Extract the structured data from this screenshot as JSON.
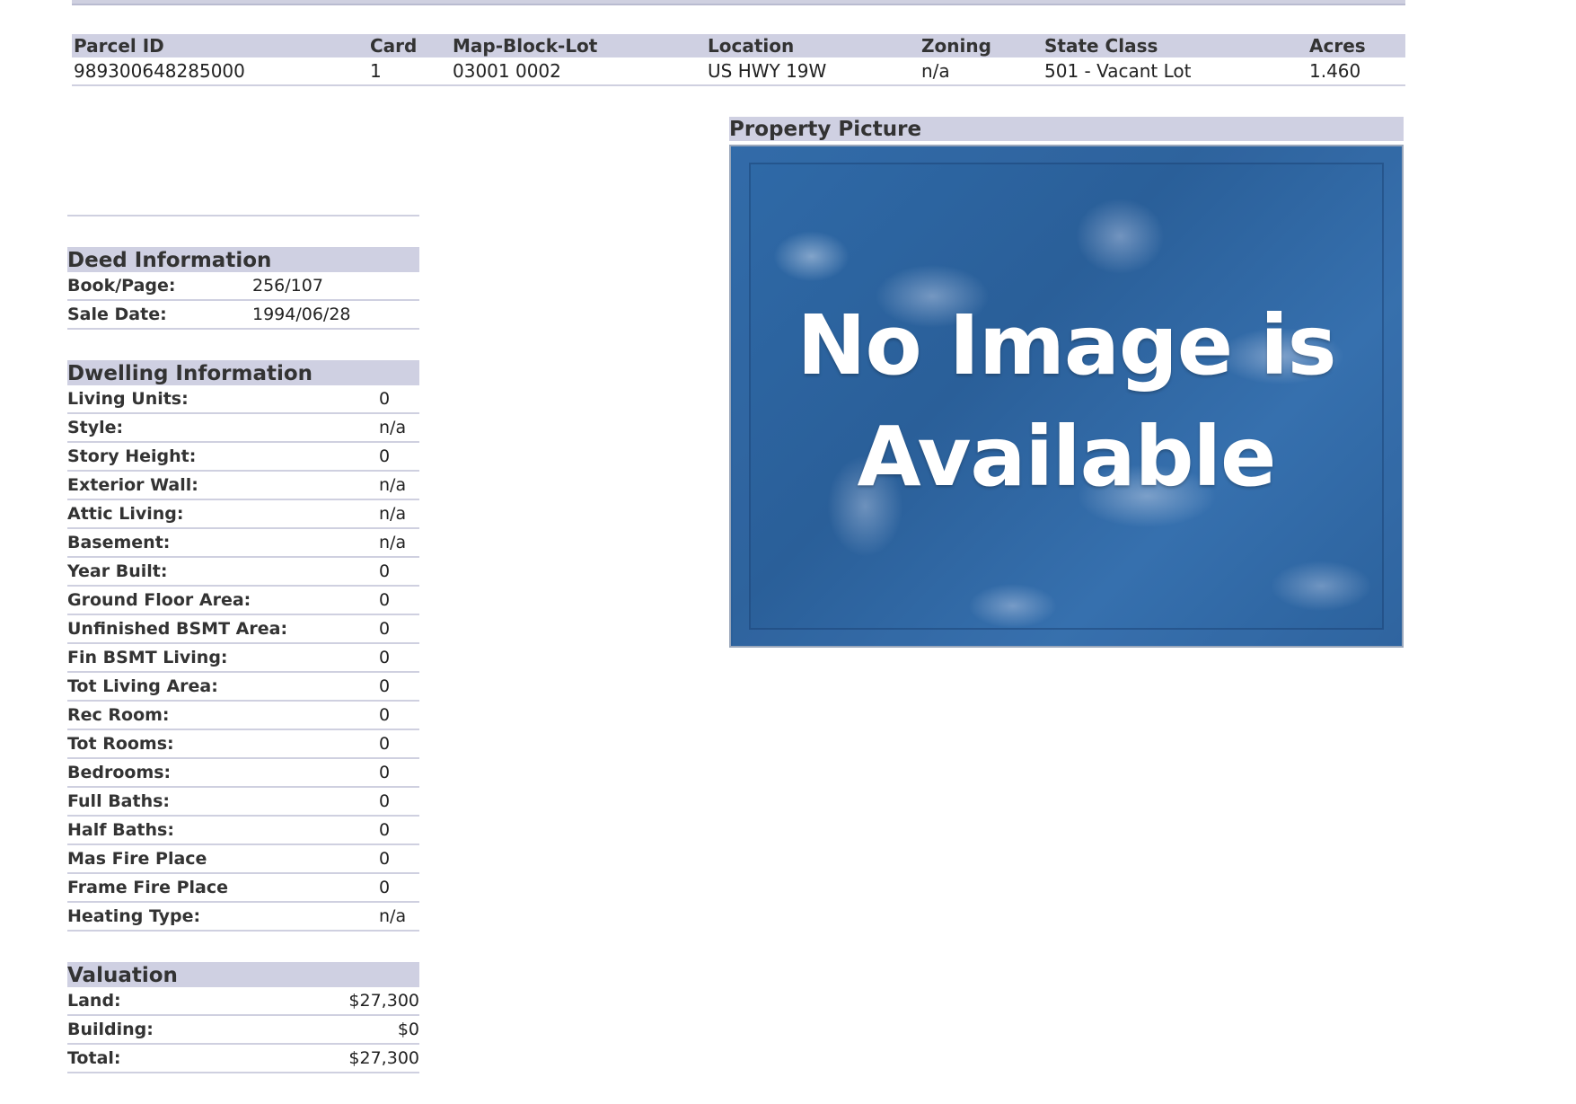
{
  "parcel": {
    "headers": [
      "Parcel ID",
      "Card",
      "Map-Block-Lot",
      "Location",
      "Zoning",
      "State Class",
      "Acres"
    ],
    "values": [
      "989300648285000",
      "1",
      "03001 0002",
      "US HWY 19W",
      "n/a",
      "501 - Vacant Lot",
      "1.460"
    ]
  },
  "deed": {
    "title": "Deed Information",
    "rows": [
      {
        "label": "Book/Page:",
        "value": "256/107"
      },
      {
        "label": "Sale Date:",
        "value": "1994/06/28"
      }
    ]
  },
  "dwelling": {
    "title": "Dwelling Information",
    "rows": [
      {
        "label": "Living Units:",
        "value": "0"
      },
      {
        "label": "Style:",
        "value": "n/a"
      },
      {
        "label": "Story Height:",
        "value": "0"
      },
      {
        "label": "Exterior Wall:",
        "value": "n/a"
      },
      {
        "label": "Attic Living:",
        "value": "n/a"
      },
      {
        "label": "Basement:",
        "value": "n/a"
      },
      {
        "label": "Year Built:",
        "value": "0"
      },
      {
        "label": "Ground Floor Area:",
        "value": "0"
      },
      {
        "label": "Unfinished BSMT Area:",
        "value": "0"
      },
      {
        "label": "Fin BSMT Living:",
        "value": "0"
      },
      {
        "label": "Tot Living Area:",
        "value": "0"
      },
      {
        "label": "Rec Room:",
        "value": "0"
      },
      {
        "label": "Tot Rooms:",
        "value": "0"
      },
      {
        "label": "Bedrooms:",
        "value": "0"
      },
      {
        "label": "Full Baths:",
        "value": "0"
      },
      {
        "label": "Half Baths:",
        "value": "0"
      },
      {
        "label": "Mas Fire Place",
        "value": "0"
      },
      {
        "label": "Frame Fire Place",
        "value": "0"
      },
      {
        "label": "Heating Type:",
        "value": "n/a"
      }
    ]
  },
  "valuation": {
    "title": "Valuation",
    "rows": [
      {
        "label": "Land:",
        "value": "$27,300"
      },
      {
        "label": "Building:",
        "value": "$0"
      },
      {
        "label": "Total:",
        "value": "$27,300"
      }
    ]
  },
  "picture": {
    "title": "Property Picture",
    "placeholder_line1": "No Image is",
    "placeholder_line2": "Available"
  }
}
